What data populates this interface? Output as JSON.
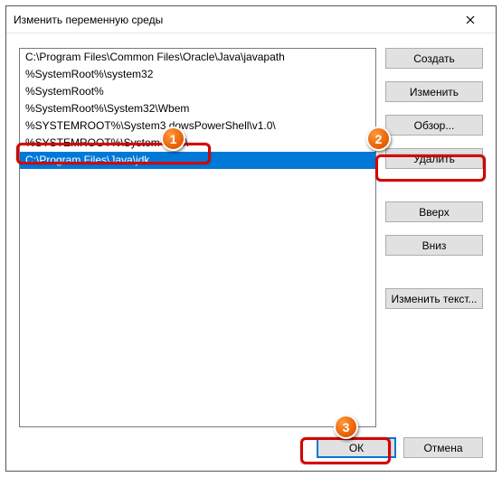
{
  "window": {
    "title": "Изменить переменную среды"
  },
  "list": {
    "items": [
      "C:\\Program Files\\Common Files\\Oracle\\Java\\javapath",
      "%SystemRoot%\\system32",
      "%SystemRoot%",
      "%SystemRoot%\\System32\\Wbem",
      "%SYSTEMROOT%\\System3      dowsPowerShell\\v1.0\\",
      "%SYSTEMROOT%\\System        SSH\\",
      "C:\\Program Files\\Java\\jdk"
    ],
    "selected_index": 6
  },
  "buttons": {
    "create": "Создать",
    "change": "Изменить",
    "browse": "Обзор...",
    "delete": "Удалить",
    "up": "Вверх",
    "down": "Вниз",
    "edit_text": "Изменить текст...",
    "ok": "ОК",
    "cancel": "Отмена"
  },
  "annotations": {
    "n1": "1",
    "n2": "2",
    "n3": "3"
  }
}
